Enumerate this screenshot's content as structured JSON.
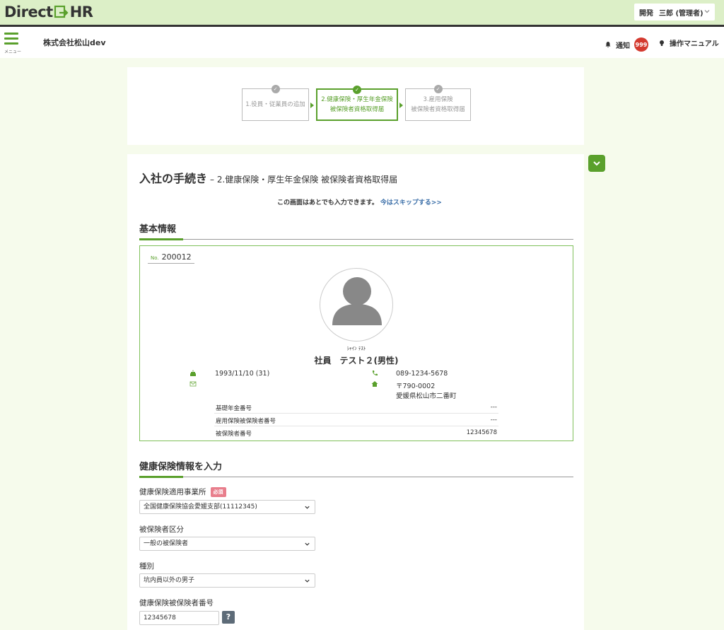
{
  "app": {
    "logo_left": "Direct",
    "logo_right": "HR"
  },
  "user_menu": {
    "department": "開発",
    "user": "三郎 (管理者)"
  },
  "header": {
    "menu_label": "メニュー",
    "company": "株式会社松山dev",
    "notify_label": "通知",
    "notify_count": "999",
    "manual_label": "操作マニュアル"
  },
  "steps": [
    {
      "line1": "1.役員・従業員の追加",
      "line2": "",
      "state": "done"
    },
    {
      "line1": "2.健康保険・厚生年金保険",
      "line2": "被保険者資格取得届",
      "state": "active"
    },
    {
      "line1": "3.雇用保険",
      "line2": "被保険者資格取得届",
      "state": "pending"
    }
  ],
  "page": {
    "title": "入社の手続き",
    "subtitle": "– 2.健康保険・厚生年金保険 被保険者資格取得届",
    "later_note": "この画面はあとでも入力できます。",
    "skip_link": "今はスキップする>>"
  },
  "basic_info": {
    "heading": "基本情報",
    "no_label": "No.",
    "employee_no": "200012",
    "kana": "ｼｬｲﾝ ﾃｽﾄ",
    "name": "社員　テスト２(男性)",
    "birthday": "1993/11/10 (31)",
    "phone": "089-1234-5678",
    "postal": "〒790-0002",
    "address": "愛媛県松山市二番町",
    "rows": [
      {
        "label": "基礎年金番号",
        "value": "---"
      },
      {
        "label": "雇用保険被保険者番号",
        "value": "---"
      },
      {
        "label": "被保険者番号",
        "value": "12345678"
      }
    ]
  },
  "form": {
    "heading": "健康保険情報を入力",
    "required_label": "必須",
    "office_label": "健康保険適用事業所",
    "office_value": "全国健康保険協会愛媛支部(11112345)",
    "category_label": "被保険者区分",
    "category_value": "一般の被保険者",
    "type_label": "種別",
    "type_value": "坑内員以外の男子",
    "insured_no_label": "健康保険被保険者番号",
    "insured_no_value": "12345678",
    "help_label": "?"
  },
  "colors": {
    "brand_green": "#5aa02c",
    "topbar": "#dcefc7",
    "page_bg": "#f6fbec",
    "badge_red": "#d43a2f",
    "required_pink": "#e87e8c"
  }
}
